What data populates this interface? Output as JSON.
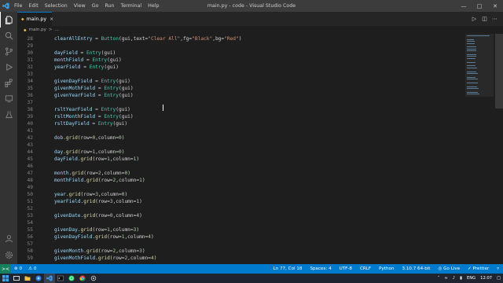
{
  "window": {
    "title": "main.py - code - Visual Studio Code",
    "menu": [
      "File",
      "Edit",
      "Selection",
      "View",
      "Go",
      "Run",
      "Terminal",
      "Help"
    ]
  },
  "tab": {
    "label": "main.py",
    "close": "×"
  },
  "breadcrumb": {
    "file": "main.py",
    "sep": ">",
    "symbol": "..."
  },
  "code_lines": [
    {
      "n": "28",
      "t": [
        [
          "clearAllEntry",
          "id"
        ],
        [
          " = ",
          ""
        ],
        [
          "Button",
          "cls"
        ],
        [
          "(gui,text=",
          ""
        ],
        [
          "\"Clear All\"",
          "str"
        ],
        [
          ",fg=",
          ""
        ],
        [
          "\"Black\"",
          "str"
        ],
        [
          ",bg=",
          ""
        ],
        [
          "\"Red\"",
          "str"
        ],
        [
          ")",
          ""
        ]
      ]
    },
    {
      "n": "29",
      "t": []
    },
    {
      "n": "30",
      "t": [
        [
          "dayField",
          "id"
        ],
        [
          " = ",
          ""
        ],
        [
          "Entry",
          "cls"
        ],
        [
          "(gui)",
          ""
        ]
      ]
    },
    {
      "n": "31",
      "t": [
        [
          "monthField",
          "id"
        ],
        [
          " = ",
          ""
        ],
        [
          "Entry",
          "cls"
        ],
        [
          "(gui)",
          ""
        ]
      ]
    },
    {
      "n": "32",
      "t": [
        [
          "yearField",
          "id"
        ],
        [
          " = ",
          ""
        ],
        [
          "Entry",
          "cls"
        ],
        [
          "(gui)",
          ""
        ]
      ]
    },
    {
      "n": "33",
      "t": []
    },
    {
      "n": "34",
      "t": [
        [
          "givenDayField",
          "id"
        ],
        [
          " = ",
          ""
        ],
        [
          "Entry",
          "cls"
        ],
        [
          "(gui)",
          ""
        ]
      ]
    },
    {
      "n": "35",
      "t": [
        [
          "givenMothField",
          "id"
        ],
        [
          " = ",
          ""
        ],
        [
          "Entry",
          "cls"
        ],
        [
          "(gui)",
          ""
        ]
      ]
    },
    {
      "n": "36",
      "t": [
        [
          "givenYearField",
          "id"
        ],
        [
          " = ",
          ""
        ],
        [
          "Entry",
          "cls"
        ],
        [
          "(gui)",
          ""
        ]
      ]
    },
    {
      "n": "37",
      "t": []
    },
    {
      "n": "38",
      "t": [
        [
          "rsltYearField",
          "id"
        ],
        [
          " = ",
          ""
        ],
        [
          "Entry",
          "cls"
        ],
        [
          "(gui)",
          ""
        ]
      ]
    },
    {
      "n": "39",
      "t": [
        [
          "rsltMonthField",
          "id"
        ],
        [
          " = ",
          ""
        ],
        [
          "Entry",
          "cls"
        ],
        [
          "(gui)",
          ""
        ]
      ]
    },
    {
      "n": "40",
      "t": [
        [
          "rsltDayField",
          "id"
        ],
        [
          " = ",
          ""
        ],
        [
          "Entry",
          "cls"
        ],
        [
          "(gui)",
          ""
        ]
      ]
    },
    {
      "n": "41",
      "t": []
    },
    {
      "n": "42",
      "t": [
        [
          "dob",
          "id"
        ],
        [
          ".",
          ""
        ],
        [
          "grid",
          "fn"
        ],
        [
          "(row=",
          ""
        ],
        [
          "0",
          "num"
        ],
        [
          ",column=",
          ""
        ],
        [
          "0",
          "num"
        ],
        [
          ")",
          ""
        ]
      ]
    },
    {
      "n": "43",
      "t": []
    },
    {
      "n": "44",
      "t": [
        [
          "day",
          "id"
        ],
        [
          ".",
          ""
        ],
        [
          "grid",
          "fn"
        ],
        [
          "(row=",
          ""
        ],
        [
          "1",
          "num"
        ],
        [
          ",column=",
          ""
        ],
        [
          "0",
          "num"
        ],
        [
          ")",
          ""
        ]
      ]
    },
    {
      "n": "45",
      "t": [
        [
          "dayField",
          "id"
        ],
        [
          ".",
          ""
        ],
        [
          "grid",
          "fn"
        ],
        [
          "(row=",
          ""
        ],
        [
          "1",
          "num"
        ],
        [
          ",column=",
          ""
        ],
        [
          "1",
          "num"
        ],
        [
          ")",
          ""
        ]
      ]
    },
    {
      "n": "46",
      "t": []
    },
    {
      "n": "47",
      "t": [
        [
          "month",
          "id"
        ],
        [
          ".",
          ""
        ],
        [
          "grid",
          "fn"
        ],
        [
          "(row=",
          ""
        ],
        [
          "2",
          "num"
        ],
        [
          ",column=",
          ""
        ],
        [
          "0",
          "num"
        ],
        [
          ")",
          ""
        ]
      ]
    },
    {
      "n": "48",
      "t": [
        [
          "monthField",
          "id"
        ],
        [
          ".",
          ""
        ],
        [
          "grid",
          "fn"
        ],
        [
          "(row=",
          ""
        ],
        [
          "2",
          "num"
        ],
        [
          ",column=",
          ""
        ],
        [
          "1",
          "num"
        ],
        [
          ")",
          ""
        ]
      ]
    },
    {
      "n": "49",
      "t": []
    },
    {
      "n": "50",
      "t": [
        [
          "year",
          "id"
        ],
        [
          ".",
          ""
        ],
        [
          "grid",
          "fn"
        ],
        [
          "(row=",
          ""
        ],
        [
          "3",
          "num"
        ],
        [
          ",column=",
          ""
        ],
        [
          "0",
          "num"
        ],
        [
          ")",
          ""
        ]
      ]
    },
    {
      "n": "51",
      "t": [
        [
          "yearField",
          "id"
        ],
        [
          ".",
          ""
        ],
        [
          "grid",
          "fn"
        ],
        [
          "(row=",
          ""
        ],
        [
          "3",
          "num"
        ],
        [
          ",column=",
          ""
        ],
        [
          "1",
          "num"
        ],
        [
          ")",
          ""
        ]
      ]
    },
    {
      "n": "52",
      "t": []
    },
    {
      "n": "53",
      "t": [
        [
          "givenDate",
          "id"
        ],
        [
          ".",
          ""
        ],
        [
          "grid",
          "fn"
        ],
        [
          "(row=",
          ""
        ],
        [
          "0",
          "num"
        ],
        [
          ",column=",
          ""
        ],
        [
          "4",
          "num"
        ],
        [
          ")",
          ""
        ]
      ]
    },
    {
      "n": "54",
      "t": []
    },
    {
      "n": "55",
      "t": [
        [
          "givenDay",
          "id"
        ],
        [
          ".",
          ""
        ],
        [
          "grid",
          "fn"
        ],
        [
          "(row=",
          ""
        ],
        [
          "1",
          "num"
        ],
        [
          ",column=",
          ""
        ],
        [
          "3",
          "num"
        ],
        [
          ")",
          ""
        ]
      ]
    },
    {
      "n": "56",
      "t": [
        [
          "givenDayField",
          "id"
        ],
        [
          ".",
          ""
        ],
        [
          "grid",
          "fn"
        ],
        [
          "(row=",
          ""
        ],
        [
          "1",
          "num"
        ],
        [
          ",column=",
          ""
        ],
        [
          "4",
          "num"
        ],
        [
          ")",
          ""
        ]
      ]
    },
    {
      "n": "57",
      "t": []
    },
    {
      "n": "58",
      "t": [
        [
          "givenMonth",
          "id"
        ],
        [
          ".",
          ""
        ],
        [
          "grid",
          "fn"
        ],
        [
          "(row=",
          ""
        ],
        [
          "2",
          "num"
        ],
        [
          ",column=",
          ""
        ],
        [
          "3",
          "num"
        ],
        [
          ")",
          ""
        ]
      ]
    },
    {
      "n": "59",
      "t": [
        [
          "givenMothField",
          "id"
        ],
        [
          ".",
          ""
        ],
        [
          "grid",
          "fn"
        ],
        [
          "(row=",
          ""
        ],
        [
          "2",
          "num"
        ],
        [
          ",column=",
          ""
        ],
        [
          "4",
          "num"
        ],
        [
          ")",
          ""
        ]
      ]
    }
  ],
  "statusbar": {
    "remote": "><",
    "errors": "⊗ 0",
    "warnings": "⚠ 0",
    "position": "Ln 77, Col 18",
    "spaces": "Spaces: 4",
    "encoding": "UTF-8",
    "eol": "CRLF",
    "language": "Python",
    "interpreter": "3.10.7 64-bit",
    "golive": "Go Live",
    "prettier": "✓ Prettier"
  },
  "taskbar": {
    "lang": "ENG",
    "region": "IN",
    "time": "12:07"
  },
  "colors": {
    "accent": "#007acc",
    "editor_bg": "#1e1e1e",
    "taskbar_bg": "#1f2530"
  }
}
